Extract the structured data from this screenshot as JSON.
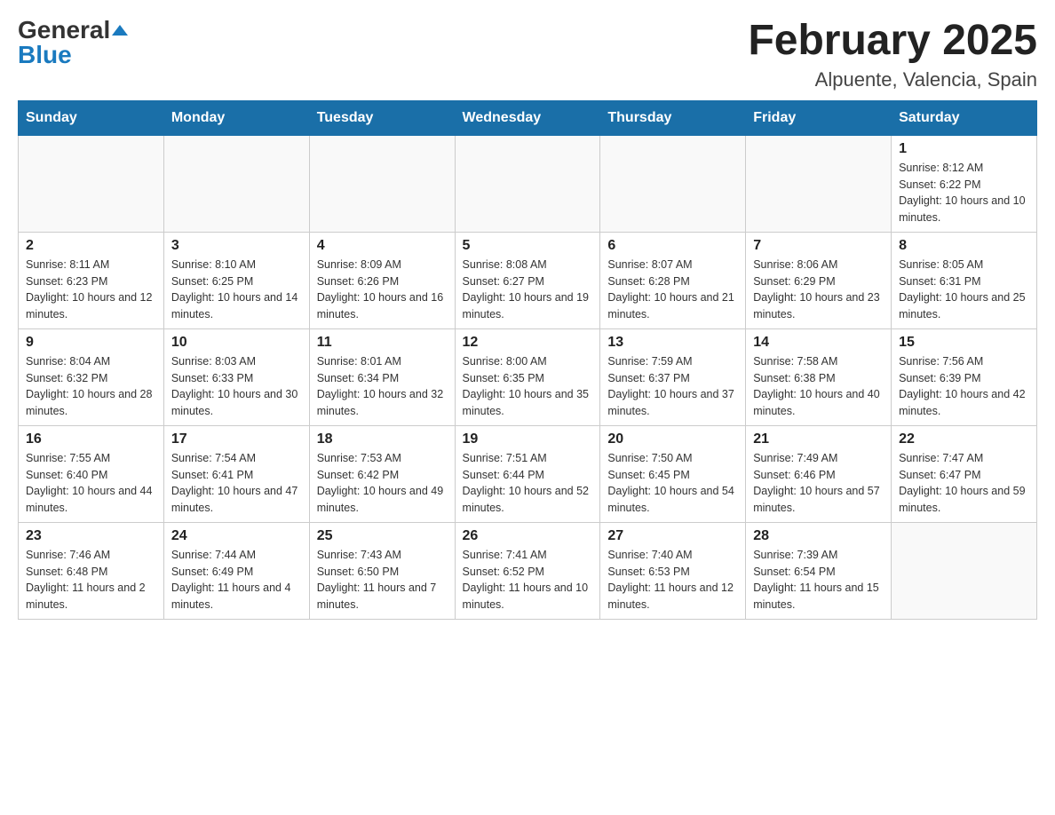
{
  "header": {
    "logo_general": "General",
    "logo_blue": "Blue",
    "month_year": "February 2025",
    "location": "Alpuente, Valencia, Spain"
  },
  "weekdays": [
    "Sunday",
    "Monday",
    "Tuesday",
    "Wednesday",
    "Thursday",
    "Friday",
    "Saturday"
  ],
  "weeks": [
    [
      {
        "day": "",
        "sunrise": "",
        "sunset": "",
        "daylight": ""
      },
      {
        "day": "",
        "sunrise": "",
        "sunset": "",
        "daylight": ""
      },
      {
        "day": "",
        "sunrise": "",
        "sunset": "",
        "daylight": ""
      },
      {
        "day": "",
        "sunrise": "",
        "sunset": "",
        "daylight": ""
      },
      {
        "day": "",
        "sunrise": "",
        "sunset": "",
        "daylight": ""
      },
      {
        "day": "",
        "sunrise": "",
        "sunset": "",
        "daylight": ""
      },
      {
        "day": "1",
        "sunrise": "Sunrise: 8:12 AM",
        "sunset": "Sunset: 6:22 PM",
        "daylight": "Daylight: 10 hours and 10 minutes."
      }
    ],
    [
      {
        "day": "2",
        "sunrise": "Sunrise: 8:11 AM",
        "sunset": "Sunset: 6:23 PM",
        "daylight": "Daylight: 10 hours and 12 minutes."
      },
      {
        "day": "3",
        "sunrise": "Sunrise: 8:10 AM",
        "sunset": "Sunset: 6:25 PM",
        "daylight": "Daylight: 10 hours and 14 minutes."
      },
      {
        "day": "4",
        "sunrise": "Sunrise: 8:09 AM",
        "sunset": "Sunset: 6:26 PM",
        "daylight": "Daylight: 10 hours and 16 minutes."
      },
      {
        "day": "5",
        "sunrise": "Sunrise: 8:08 AM",
        "sunset": "Sunset: 6:27 PM",
        "daylight": "Daylight: 10 hours and 19 minutes."
      },
      {
        "day": "6",
        "sunrise": "Sunrise: 8:07 AM",
        "sunset": "Sunset: 6:28 PM",
        "daylight": "Daylight: 10 hours and 21 minutes."
      },
      {
        "day": "7",
        "sunrise": "Sunrise: 8:06 AM",
        "sunset": "Sunset: 6:29 PM",
        "daylight": "Daylight: 10 hours and 23 minutes."
      },
      {
        "day": "8",
        "sunrise": "Sunrise: 8:05 AM",
        "sunset": "Sunset: 6:31 PM",
        "daylight": "Daylight: 10 hours and 25 minutes."
      }
    ],
    [
      {
        "day": "9",
        "sunrise": "Sunrise: 8:04 AM",
        "sunset": "Sunset: 6:32 PM",
        "daylight": "Daylight: 10 hours and 28 minutes."
      },
      {
        "day": "10",
        "sunrise": "Sunrise: 8:03 AM",
        "sunset": "Sunset: 6:33 PM",
        "daylight": "Daylight: 10 hours and 30 minutes."
      },
      {
        "day": "11",
        "sunrise": "Sunrise: 8:01 AM",
        "sunset": "Sunset: 6:34 PM",
        "daylight": "Daylight: 10 hours and 32 minutes."
      },
      {
        "day": "12",
        "sunrise": "Sunrise: 8:00 AM",
        "sunset": "Sunset: 6:35 PM",
        "daylight": "Daylight: 10 hours and 35 minutes."
      },
      {
        "day": "13",
        "sunrise": "Sunrise: 7:59 AM",
        "sunset": "Sunset: 6:37 PM",
        "daylight": "Daylight: 10 hours and 37 minutes."
      },
      {
        "day": "14",
        "sunrise": "Sunrise: 7:58 AM",
        "sunset": "Sunset: 6:38 PM",
        "daylight": "Daylight: 10 hours and 40 minutes."
      },
      {
        "day": "15",
        "sunrise": "Sunrise: 7:56 AM",
        "sunset": "Sunset: 6:39 PM",
        "daylight": "Daylight: 10 hours and 42 minutes."
      }
    ],
    [
      {
        "day": "16",
        "sunrise": "Sunrise: 7:55 AM",
        "sunset": "Sunset: 6:40 PM",
        "daylight": "Daylight: 10 hours and 44 minutes."
      },
      {
        "day": "17",
        "sunrise": "Sunrise: 7:54 AM",
        "sunset": "Sunset: 6:41 PM",
        "daylight": "Daylight: 10 hours and 47 minutes."
      },
      {
        "day": "18",
        "sunrise": "Sunrise: 7:53 AM",
        "sunset": "Sunset: 6:42 PM",
        "daylight": "Daylight: 10 hours and 49 minutes."
      },
      {
        "day": "19",
        "sunrise": "Sunrise: 7:51 AM",
        "sunset": "Sunset: 6:44 PM",
        "daylight": "Daylight: 10 hours and 52 minutes."
      },
      {
        "day": "20",
        "sunrise": "Sunrise: 7:50 AM",
        "sunset": "Sunset: 6:45 PM",
        "daylight": "Daylight: 10 hours and 54 minutes."
      },
      {
        "day": "21",
        "sunrise": "Sunrise: 7:49 AM",
        "sunset": "Sunset: 6:46 PM",
        "daylight": "Daylight: 10 hours and 57 minutes."
      },
      {
        "day": "22",
        "sunrise": "Sunrise: 7:47 AM",
        "sunset": "Sunset: 6:47 PM",
        "daylight": "Daylight: 10 hours and 59 minutes."
      }
    ],
    [
      {
        "day": "23",
        "sunrise": "Sunrise: 7:46 AM",
        "sunset": "Sunset: 6:48 PM",
        "daylight": "Daylight: 11 hours and 2 minutes."
      },
      {
        "day": "24",
        "sunrise": "Sunrise: 7:44 AM",
        "sunset": "Sunset: 6:49 PM",
        "daylight": "Daylight: 11 hours and 4 minutes."
      },
      {
        "day": "25",
        "sunrise": "Sunrise: 7:43 AM",
        "sunset": "Sunset: 6:50 PM",
        "daylight": "Daylight: 11 hours and 7 minutes."
      },
      {
        "day": "26",
        "sunrise": "Sunrise: 7:41 AM",
        "sunset": "Sunset: 6:52 PM",
        "daylight": "Daylight: 11 hours and 10 minutes."
      },
      {
        "day": "27",
        "sunrise": "Sunrise: 7:40 AM",
        "sunset": "Sunset: 6:53 PM",
        "daylight": "Daylight: 11 hours and 12 minutes."
      },
      {
        "day": "28",
        "sunrise": "Sunrise: 7:39 AM",
        "sunset": "Sunset: 6:54 PM",
        "daylight": "Daylight: 11 hours and 15 minutes."
      },
      {
        "day": "",
        "sunrise": "",
        "sunset": "",
        "daylight": ""
      }
    ]
  ]
}
